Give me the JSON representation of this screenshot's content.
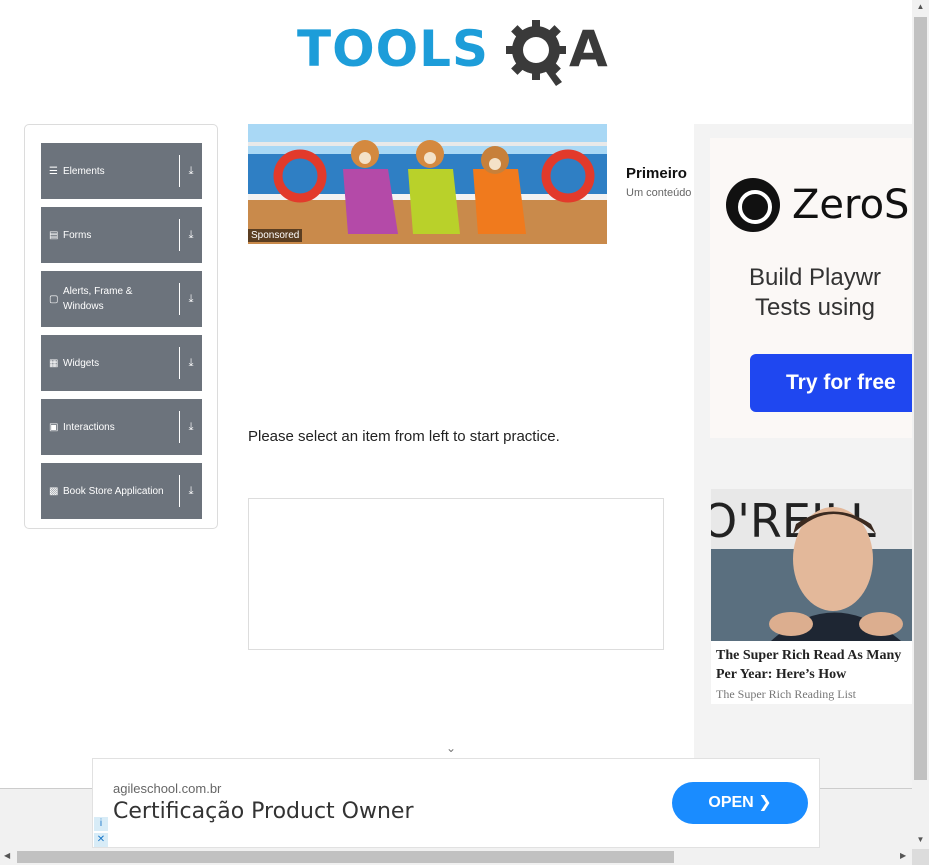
{
  "logo": {
    "tools": "TOOLS",
    "a": "A"
  },
  "sidebar": {
    "groups": [
      {
        "label": "Elements",
        "icon": "menu-icon"
      },
      {
        "label": "Forms",
        "icon": "form-icon"
      },
      {
        "label": "Alerts, Frame & Windows",
        "icon": "window-icon"
      },
      {
        "label": "Widgets",
        "icon": "widgets-icon"
      },
      {
        "label": "Interactions",
        "icon": "interactions-icon"
      },
      {
        "label": "Book Store Application",
        "icon": "book-icon"
      }
    ]
  },
  "ad_top": {
    "sponsored": "Sponsored",
    "title": "Primeiro",
    "subtitle": "Um conteúdo"
  },
  "main": {
    "practice_text": "Please select an item from left to start practice."
  },
  "right_ad": {
    "brand": "ZeroS",
    "line1": "Build Playwr",
    "line2": "Tests using",
    "cta": "Try for free",
    "news_brand_text": "O'REILL",
    "news_title_line1": "The Super Rich Read As Many",
    "news_title_line2": "Per Year: Here’s How",
    "news_source": "The Super Rich Reading List"
  },
  "bottom_ad": {
    "domain": "agileschool.com.br",
    "title": "Certificação Product Owner",
    "cta": "OPEN"
  },
  "colors": {
    "logo_blue": "#1d9dd9",
    "sidebar_group": "#6c737c",
    "cta_blue": "#1f47f0",
    "open_blue": "#1a8cff"
  }
}
